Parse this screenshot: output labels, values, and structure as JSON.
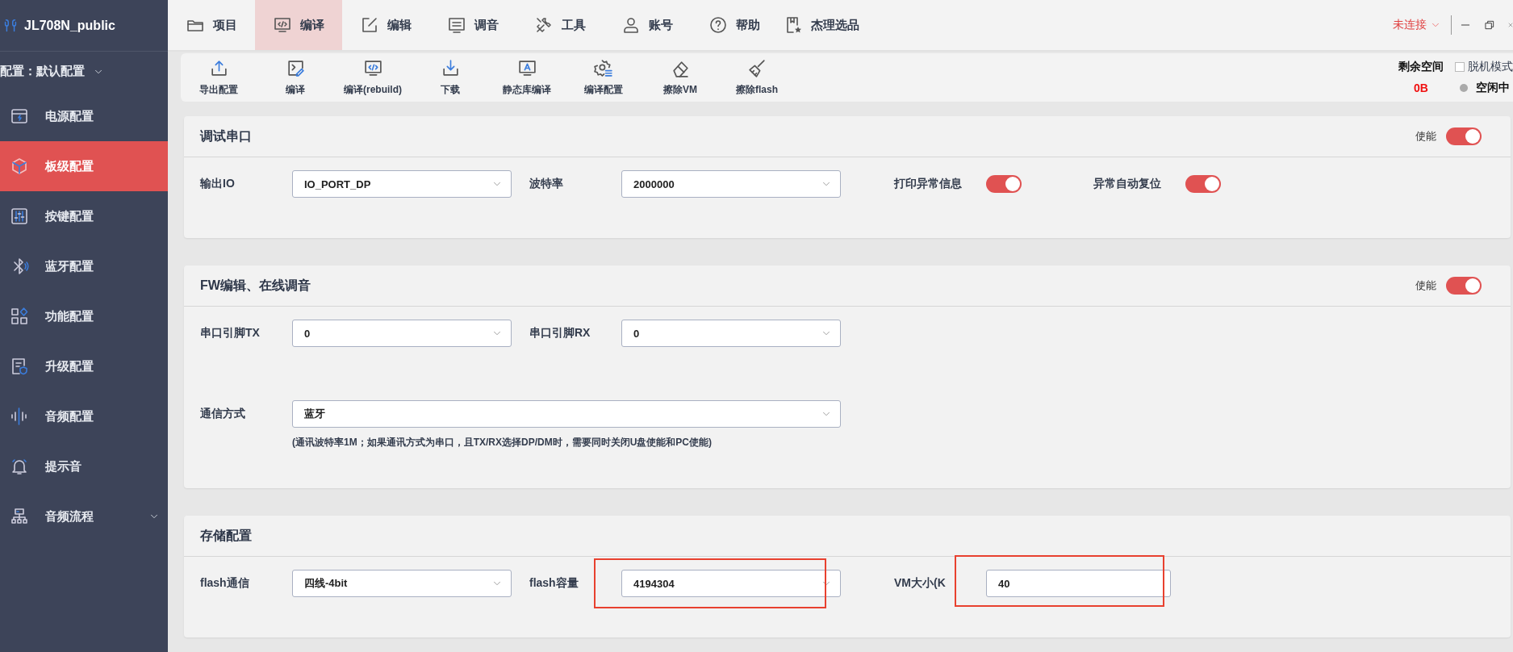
{
  "app_title": "JL708N_public",
  "config_selector": {
    "label": "配置：默认配置"
  },
  "nav_tabs": [
    {
      "label": "项目",
      "selected": false
    },
    {
      "label": "编译",
      "selected": true
    },
    {
      "label": "编辑",
      "selected": false
    },
    {
      "label": "调音",
      "selected": false
    },
    {
      "label": "工具",
      "selected": false
    },
    {
      "label": "账号",
      "selected": false
    },
    {
      "label": "帮助",
      "selected": false
    },
    {
      "label": "杰理选品",
      "selected": false
    }
  ],
  "connection": {
    "label": "未连接"
  },
  "toolbar": [
    {
      "label": "导出配置"
    },
    {
      "label": "编译"
    },
    {
      "label": "编译(rebuild)"
    },
    {
      "label": "下载"
    },
    {
      "label": "静态库编译"
    },
    {
      "label": "编译配置"
    },
    {
      "label": "擦除VM"
    },
    {
      "label": "擦除flash"
    }
  ],
  "storage_info": {
    "label": "剩余空间",
    "value": "0B"
  },
  "offline_mode": {
    "label": "脱机模式",
    "checked": false
  },
  "status": {
    "label": "空闲中"
  },
  "sidebar": {
    "items": [
      {
        "label": "电源配置",
        "selected": false
      },
      {
        "label": "板级配置",
        "selected": true
      },
      {
        "label": "按键配置",
        "selected": false
      },
      {
        "label": "蓝牙配置",
        "selected": false
      },
      {
        "label": "功能配置",
        "selected": false
      },
      {
        "label": "升级配置",
        "selected": false
      },
      {
        "label": "音频配置",
        "selected": false
      },
      {
        "label": "提示音",
        "selected": false
      },
      {
        "label": "音频流程",
        "selected": false,
        "expanded": false
      }
    ]
  },
  "sections": [
    {
      "title": "调试串口",
      "enable": {
        "label": "使能",
        "on": true
      },
      "rows": [
        {
          "fields": [
            {
              "kind": "select",
              "label": "输出IO",
              "value": "IO_PORT_DP",
              "highlighted": false
            },
            {
              "kind": "select",
              "label": "波特率",
              "value": "2000000",
              "highlighted": false
            },
            {
              "kind": "toggle",
              "label": "打印异常信息",
              "on": true
            },
            {
              "kind": "toggle",
              "label": "异常自动复位",
              "on": true
            }
          ]
        }
      ]
    },
    {
      "title": "FW编辑、在线调音",
      "enable": {
        "label": "使能",
        "on": true
      },
      "rows": [
        {
          "fields": [
            {
              "kind": "select",
              "label": "串口引脚TX",
              "value": "0",
              "highlighted": false
            },
            {
              "kind": "select",
              "label": "串口引脚RX",
              "value": "0",
              "highlighted": false
            }
          ]
        },
        {
          "fields": [
            {
              "kind": "select",
              "label": "通信方式",
              "value": "蓝牙",
              "highlighted": false
            }
          ],
          "note": "(通讯波特率1M；如果通讯方式为串口，且TX/RX选择DP/DM时，需要同时关闭U盘使能和PC使能)"
        }
      ]
    },
    {
      "title": "存储配置",
      "rows": [
        {
          "fields": [
            {
              "kind": "select",
              "label": "flash通信",
              "value": "四线-4bit",
              "highlighted": false
            },
            {
              "kind": "select",
              "label": "flash容量",
              "value": "4194304",
              "highlighted": true
            },
            {
              "kind": "input",
              "label": "VM大小(K",
              "value": "40",
              "highlighted": true
            }
          ]
        }
      ]
    }
  ]
}
